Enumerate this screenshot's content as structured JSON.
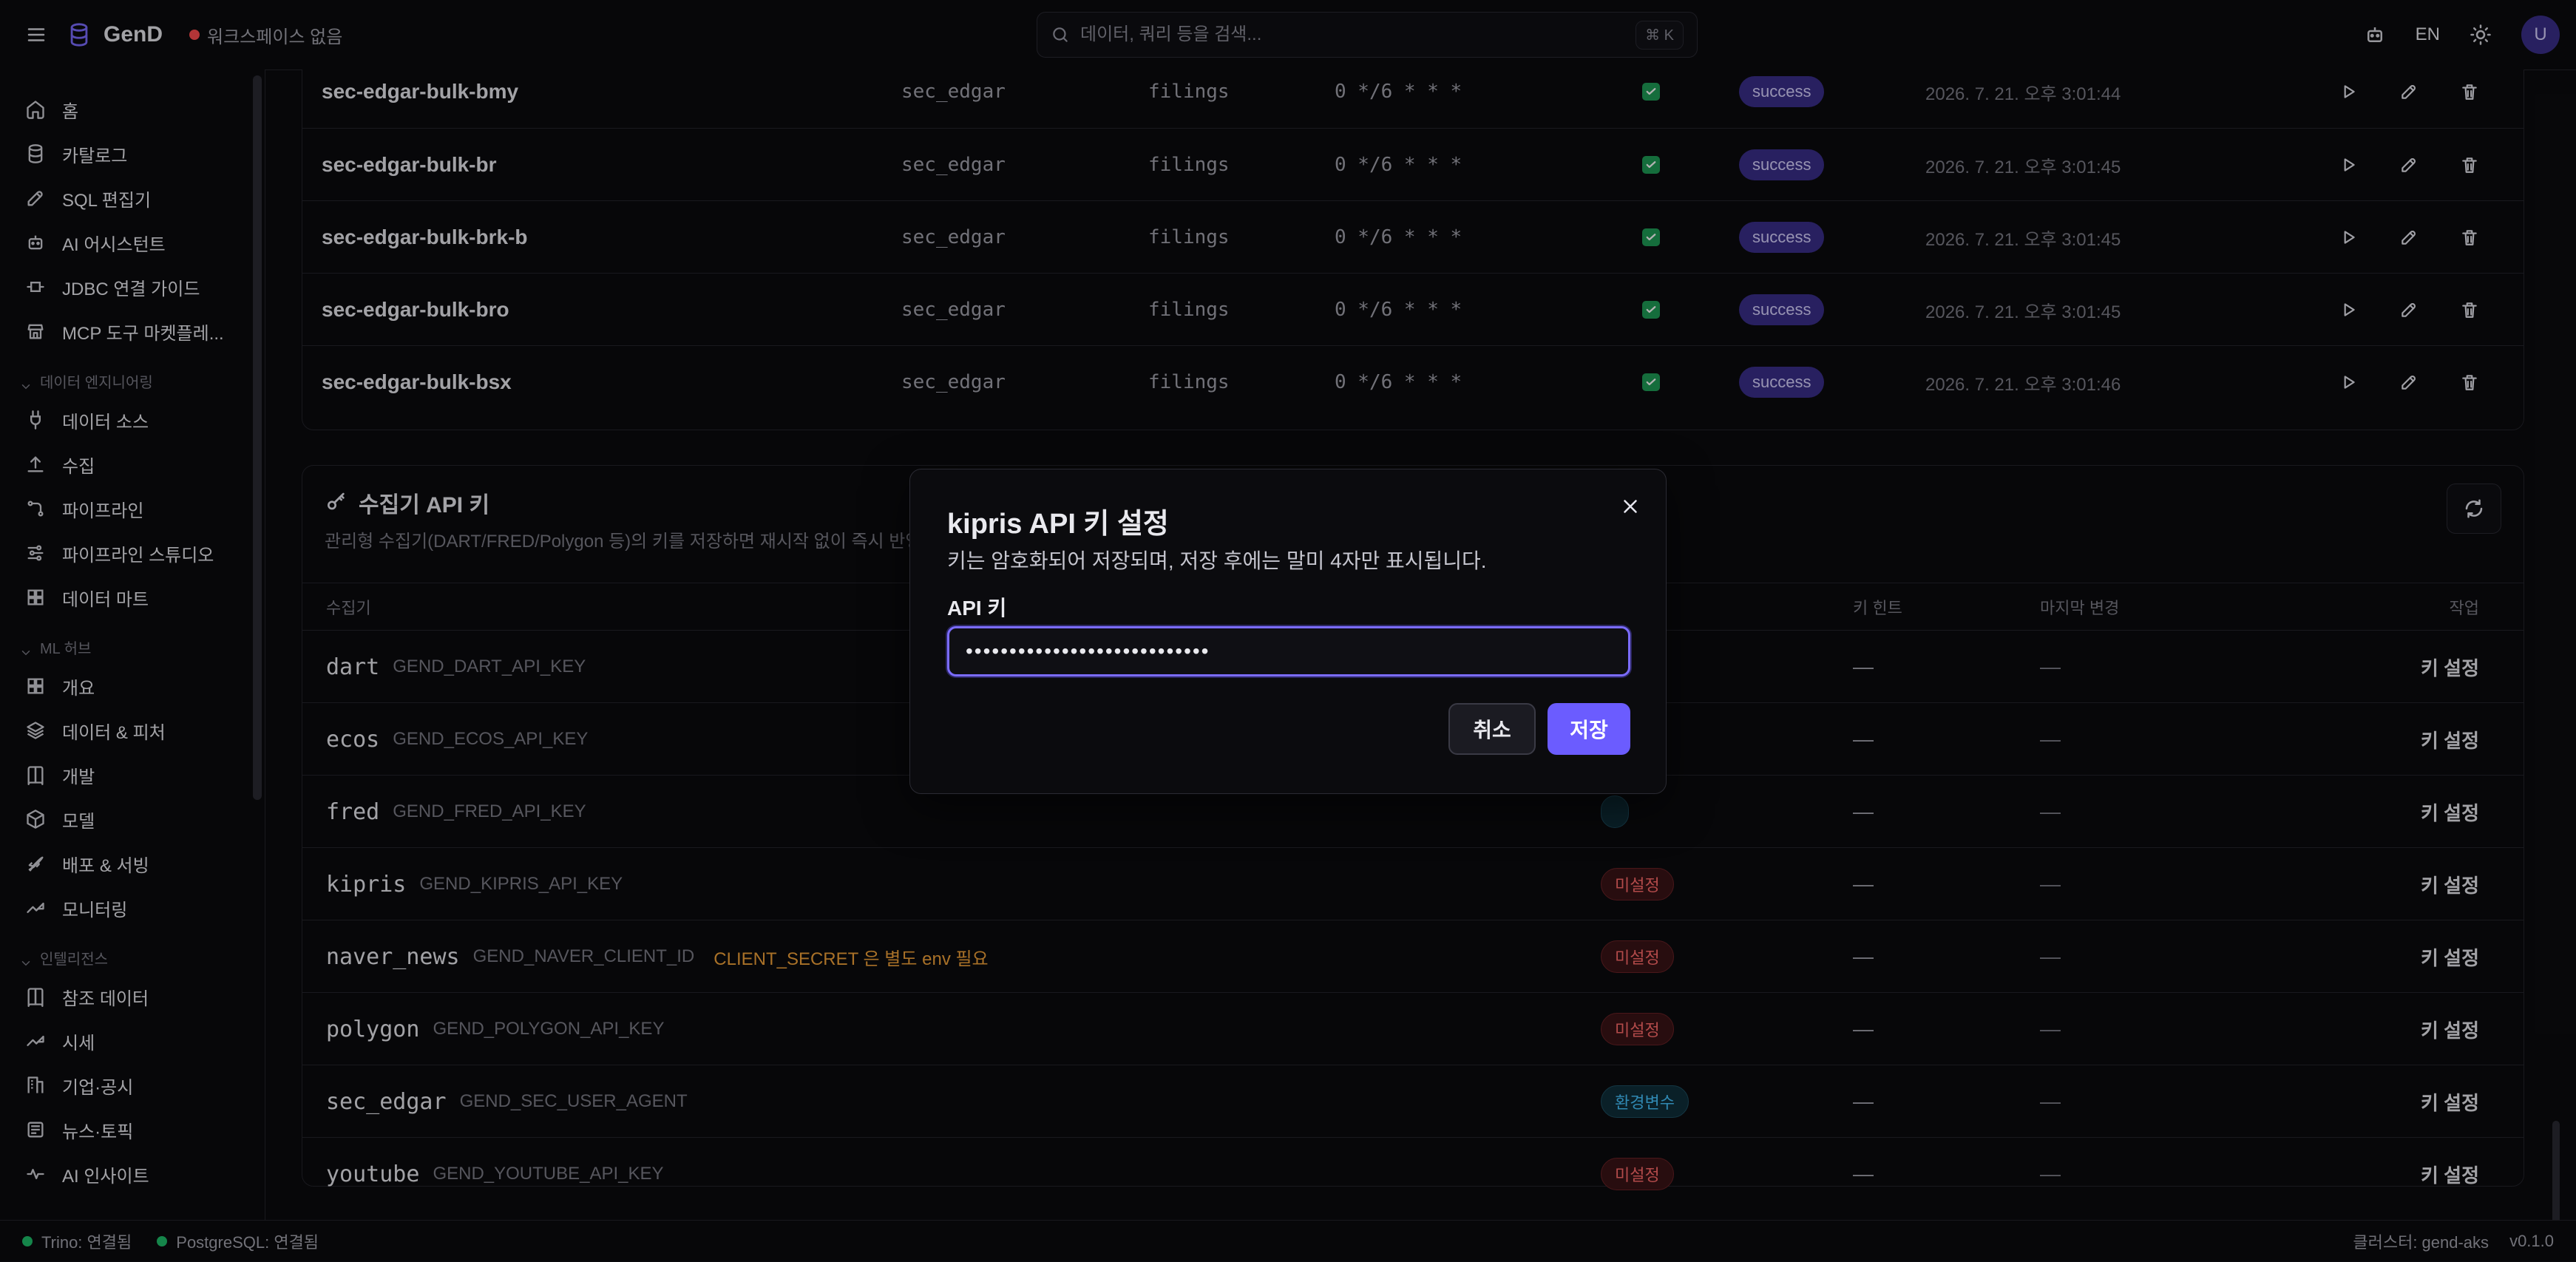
{
  "topbar": {
    "brand": "GenD",
    "workspace": "워크스페이스 없음",
    "search_placeholder": "데이터, 쿼리 등을 검색...",
    "search_shortcut": "⌘ K",
    "language": "EN",
    "avatar_initial": "U"
  },
  "sidebar": {
    "top_items": [
      {
        "label": "홈",
        "icon": "home-icon"
      },
      {
        "label": "카탈로그",
        "icon": "database-icon"
      },
      {
        "label": "SQL 편집기",
        "icon": "edit-icon"
      },
      {
        "label": "AI 어시스턴트",
        "icon": "bot-icon"
      },
      {
        "label": "JDBC 연결 가이드",
        "icon": "jdbc-icon"
      },
      {
        "label": "MCP 도구 마켓플레...",
        "icon": "store-icon"
      }
    ],
    "sections": [
      {
        "title": "데이터 엔지니어링",
        "items": [
          {
            "label": "데이터 소스",
            "icon": "plug-icon"
          },
          {
            "label": "수집",
            "icon": "upload-icon"
          },
          {
            "label": "파이프라인",
            "icon": "pipeline-icon"
          },
          {
            "label": "파이프라인 스튜디오",
            "icon": "studio-icon"
          },
          {
            "label": "데이터 마트",
            "icon": "grid-icon"
          }
        ]
      },
      {
        "title": "ML 허브",
        "items": [
          {
            "label": "개요",
            "icon": "grid-icon"
          },
          {
            "label": "데이터 & 피처",
            "icon": "layers-icon"
          },
          {
            "label": "개발",
            "icon": "book-icon"
          },
          {
            "label": "모델",
            "icon": "cube-icon"
          },
          {
            "label": "배포 & 서빙",
            "icon": "rocket-icon"
          },
          {
            "label": "모니터링",
            "icon": "trend-icon"
          }
        ]
      },
      {
        "title": "인텔리전스",
        "items": [
          {
            "label": "참조 데이터",
            "icon": "book-icon"
          },
          {
            "label": "시세",
            "icon": "trend-icon"
          },
          {
            "label": "기업·공시",
            "icon": "building-icon"
          },
          {
            "label": "뉴스·토픽",
            "icon": "news-icon"
          },
          {
            "label": "AI 인사이트",
            "icon": "pulse-icon"
          }
        ]
      }
    ]
  },
  "jobs": {
    "rows": [
      {
        "name": "sec-edgar-bulk-bmy",
        "source": "sec_edgar",
        "table": "filings",
        "schedule": "0 */6 * * *",
        "status": "success",
        "last_run": "2026. 7. 21. 오후 3:01:44"
      },
      {
        "name": "sec-edgar-bulk-br",
        "source": "sec_edgar",
        "table": "filings",
        "schedule": "0 */6 * * *",
        "status": "success",
        "last_run": "2026. 7. 21. 오후 3:01:45"
      },
      {
        "name": "sec-edgar-bulk-brk-b",
        "source": "sec_edgar",
        "table": "filings",
        "schedule": "0 */6 * * *",
        "status": "success",
        "last_run": "2026. 7. 21. 오후 3:01:45"
      },
      {
        "name": "sec-edgar-bulk-bro",
        "source": "sec_edgar",
        "table": "filings",
        "schedule": "0 */6 * * *",
        "status": "success",
        "last_run": "2026. 7. 21. 오후 3:01:45"
      },
      {
        "name": "sec-edgar-bulk-bsx",
        "source": "sec_edgar",
        "table": "filings",
        "schedule": "0 */6 * * *",
        "status": "success",
        "last_run": "2026. 7. 21. 오후 3:01:46"
      }
    ]
  },
  "keys": {
    "title": "수집기 API 키",
    "description": "관리형 수집기(DART/FRED/Polygon 등)의 키를 저장하면 재시작 없이 즉시 반영됩",
    "headers": {
      "collector": "수집기",
      "hint": "키 힌트",
      "last_changed": "마지막 변경",
      "action": "작업"
    },
    "rows": [
      {
        "name": "dart",
        "env": "GEND_DART_API_KEY",
        "note": "",
        "status": "",
        "hint": "—",
        "last": "—",
        "action": "키 설정"
      },
      {
        "name": "ecos",
        "env": "GEND_ECOS_API_KEY",
        "note": "",
        "status": "",
        "hint": "—",
        "last": "—",
        "action": "키 설정"
      },
      {
        "name": "fred",
        "env": "GEND_FRED_API_KEY",
        "note": "",
        "status": "",
        "hint": "—",
        "last": "—",
        "action": "키 설정"
      },
      {
        "name": "kipris",
        "env": "GEND_KIPRIS_API_KEY",
        "note": "",
        "status": "미설정",
        "hint": "—",
        "last": "—",
        "action": "키 설정"
      },
      {
        "name": "naver_news",
        "env": "GEND_NAVER_CLIENT_ID",
        "note": "CLIENT_SECRET 은 별도 env 필요",
        "status": "미설정",
        "hint": "—",
        "last": "—",
        "action": "키 설정"
      },
      {
        "name": "polygon",
        "env": "GEND_POLYGON_API_KEY",
        "note": "",
        "status": "미설정",
        "hint": "—",
        "last": "—",
        "action": "키 설정"
      },
      {
        "name": "sec_edgar",
        "env": "GEND_SEC_USER_AGENT",
        "note": "",
        "status": "환경변수",
        "hint": "—",
        "last": "—",
        "action": "키 설정"
      },
      {
        "name": "youtube",
        "env": "GEND_YOUTUBE_API_KEY",
        "note": "",
        "status": "미설정",
        "hint": "—",
        "last": "—",
        "action": "키 설정"
      }
    ]
  },
  "modal": {
    "title": "kipris API 키 설정",
    "description": "키는 암호화되어 저장되며, 저장 후에는 말미 4자만 표시됩니다.",
    "label": "API 키",
    "masked_value": "••••••••••••••••••••••••••••",
    "cancel": "취소",
    "save": "저장"
  },
  "footer": {
    "trino": "Trino: 연결됨",
    "postgres": "PostgreSQL: 연결됨",
    "cluster": "클러스터: gend-aks",
    "version": "v0.1.0"
  }
}
